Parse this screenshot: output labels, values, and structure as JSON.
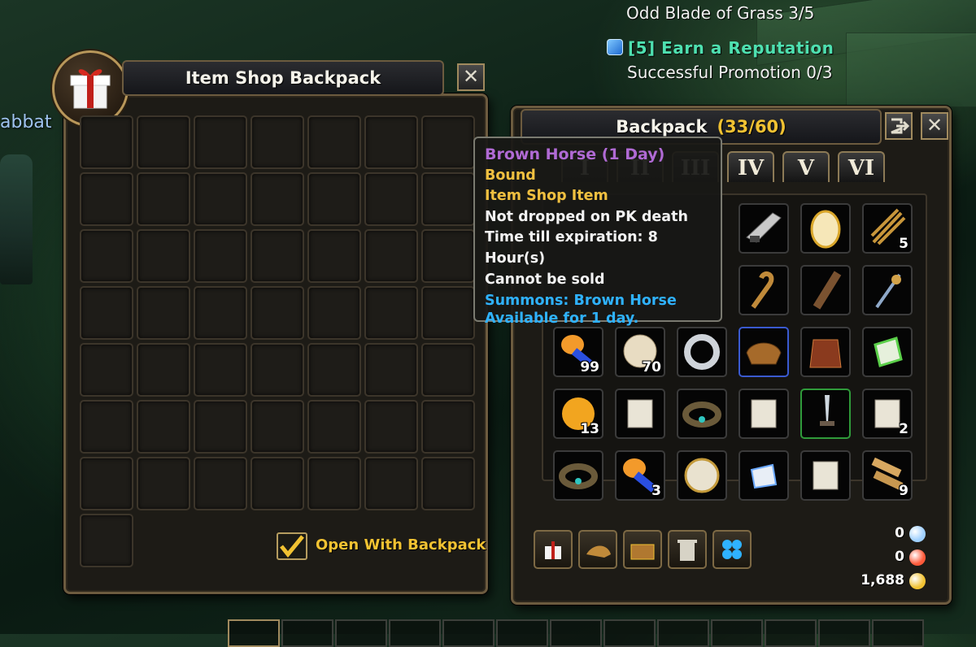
{
  "quests": [
    {
      "title": "",
      "sub": "Odd Blade of Grass 3/5"
    },
    {
      "title": "[5] Earn a Reputation",
      "sub": "Successful Promotion 0/3"
    }
  ],
  "side_name": "abbat",
  "item_shop": {
    "title": "Item Shop Backpack",
    "open_with_backpack": "Open With Backpack",
    "open_with_backpack_checked": true,
    "close_glyph": "✕"
  },
  "backpack": {
    "title": "Backpack",
    "capacity": "(33/60)",
    "close_glyph": "✕",
    "tabs": [
      "I",
      "II",
      "III",
      "IV",
      "V",
      "VI"
    ],
    "rows": [
      [
        {
          "icon": "sword-blade-icon"
        },
        {
          "icon": "golden-egg-icon"
        },
        {
          "icon": "arrow-bundle-icon",
          "qty": "5"
        }
      ],
      [
        {
          "icon": "staff-hook-icon"
        },
        {
          "icon": "quiver-icon"
        },
        {
          "icon": "fishing-rod-icon"
        }
      ],
      [
        {
          "icon": "potion-blue-icon",
          "qty": "99"
        },
        {
          "icon": "stone-rune-icon",
          "qty": "70"
        },
        {
          "icon": "silver-ring-icon"
        },
        {
          "icon": "saddle-icon"
        },
        {
          "icon": "armor-icon"
        },
        {
          "icon": "green-gem-icon"
        }
      ],
      [
        {
          "icon": "ore-chunk-icon",
          "qty": "13"
        },
        {
          "icon": "scroll-icon"
        },
        {
          "icon": "bracelet-icon"
        },
        {
          "icon": "scroll-icon"
        },
        {
          "icon": "dagger-icon"
        },
        {
          "icon": "scroll-icon",
          "qty": "2"
        }
      ],
      [
        {
          "icon": "bracelet-icon"
        },
        {
          "icon": "potion-blue-icon",
          "qty": "3"
        },
        {
          "icon": "rune-stone-icon"
        },
        {
          "icon": "crystal-shard-icon"
        },
        {
          "icon": "scroll-icon"
        },
        {
          "icon": "log-bundle-icon",
          "qty": "9"
        }
      ]
    ],
    "toolbar": [
      "gift-icon",
      "horn-icon",
      "chest-icon",
      "trash-icon",
      "orbs-icon"
    ],
    "currency": [
      {
        "value": "0",
        "icon": "crystal-icon",
        "color": "#9fd0ff"
      },
      {
        "value": "0",
        "icon": "ruby-icon",
        "color": "#ff5a3a"
      },
      {
        "value": "1,688",
        "icon": "gold-coin-icon",
        "color": "#f1c232"
      }
    ]
  },
  "tooltip": {
    "name": "Brown Horse (1 Day)",
    "bound": "Bound",
    "shop": "Item Shop Item",
    "line1": "Not dropped on PK death",
    "line2": "Time till expiration: 8 Hour(s)",
    "line3": "Cannot be sold",
    "desc1": "Summons: Brown Horse",
    "desc2": "Available for 1 day.",
    "colors": {
      "name": "#b06ad4",
      "gold": "#f0c040",
      "white": "#f2f2f2",
      "blue": "#2fb2ff"
    }
  }
}
